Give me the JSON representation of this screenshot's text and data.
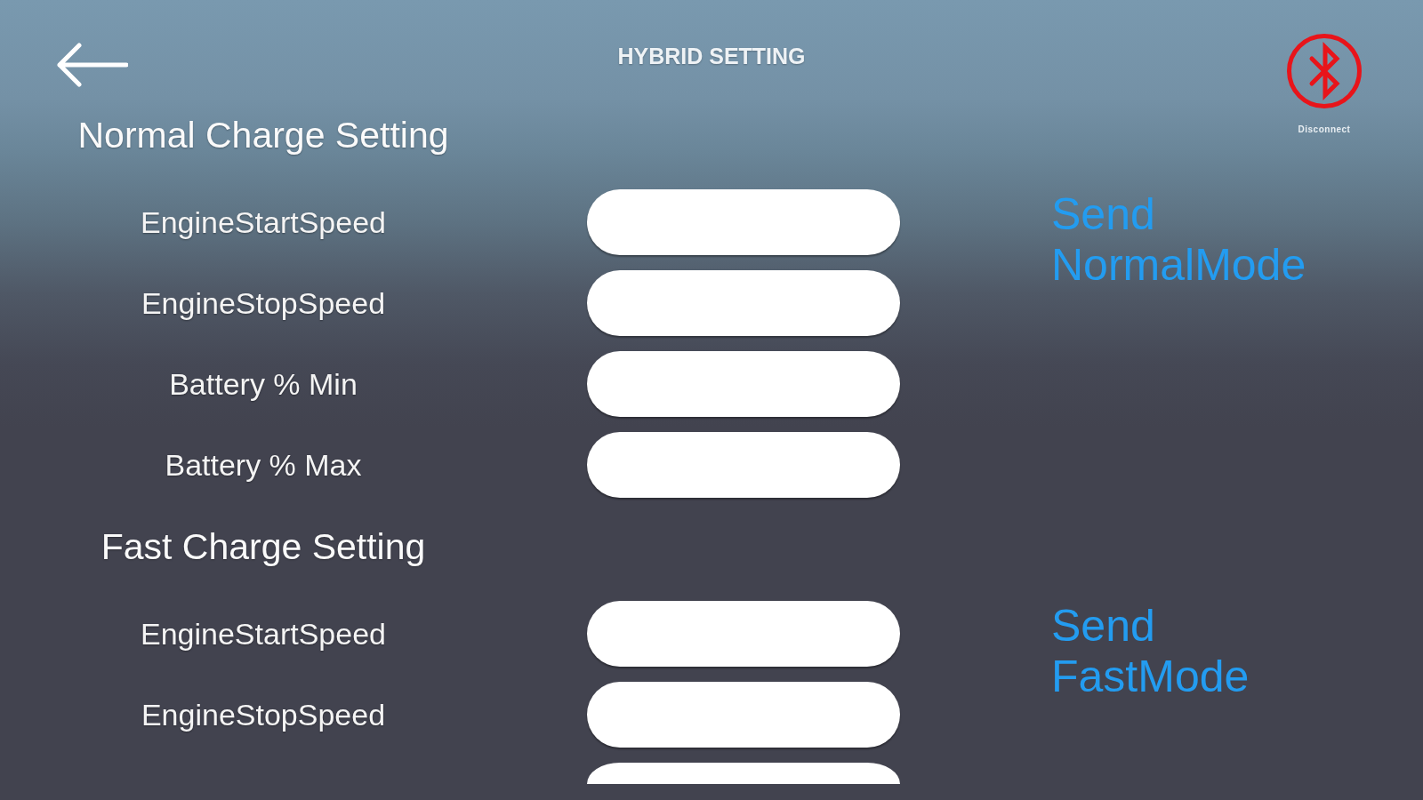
{
  "header": {
    "title": "HYBRID SETTING",
    "bluetooth": {
      "connected": false,
      "status": "Disconnect"
    }
  },
  "sections": [
    {
      "title": "Normal Charge Setting",
      "rows": [
        {
          "label": "EngineStartSpeed"
        },
        {
          "label": "EngineStopSpeed"
        },
        {
          "label": "Battery % Min"
        },
        {
          "label": "Battery % Max"
        }
      ],
      "send_button": "Send NormalMode"
    },
    {
      "title": "Fast Charge Setting",
      "rows": [
        {
          "label": "EngineStartSpeed"
        },
        {
          "label": "EngineStopSpeed"
        }
      ],
      "send_button": "Send FastMode",
      "next_row_cut_off": true
    }
  ]
}
